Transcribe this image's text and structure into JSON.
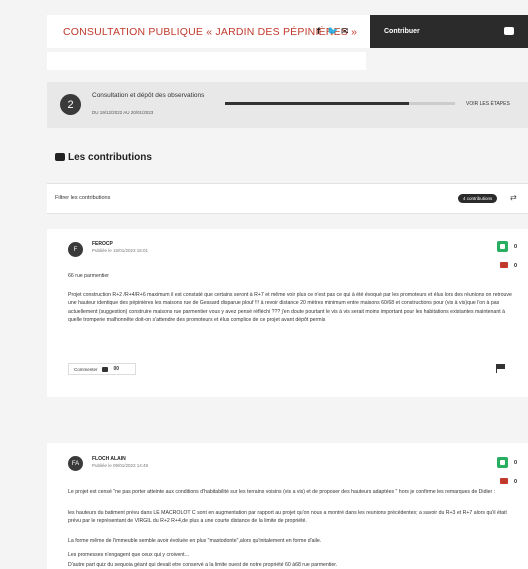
{
  "header": {
    "title": "CONSULTATION PUBLIQUE « JARDIN DES PÉPINIÈRES »",
    "share_icons": [
      "facebook-icon",
      "twitter-icon",
      "mail-icon"
    ],
    "contribute_label": "Contribuer"
  },
  "phase": {
    "number": "2",
    "label": "Consultation et dépôt des observations",
    "dates": "DU 19/12/2022 AU 20/01/2023",
    "progress": 0.8,
    "steps_link": "VOIR LES ÉTAPES"
  },
  "contributions": {
    "title": "Les contributions",
    "filter_label": "Filtrer les contributions",
    "count_label": "4 contributions"
  },
  "posts": [
    {
      "initial": "F",
      "author": "FEROCP",
      "date": "Publiée le 15/01/2023 16:01",
      "up": "0",
      "down": "0",
      "subject": "66 rue parmentier",
      "paragraphs": [
        "Projet construction R+2 /R+4/R+6 maximum il est constaté que certains seront à R+7 et même voir plus ce n'est pas ce qui à été évoqué par les promoteurs et élus lors des réunions on retrouve une hauteur identique des pépinières les maisons rue de Gessard disparue plouf !!! à revoir distance 20 mètres minimum entre maisons 60/68 et constructions pour (vis à vis)que l'on à pas actuellement (suggestion) construire maisons rue parmentier vous y avez pensé réfléchi ??? j'en doute pourtant le vis à vis serait moins important pour les habitations existantes maintenant à quelle tromperie malhonnête doit-on s'attendre des promoteurs et élus complice de ce projet avant dépôt permis"
      ],
      "comment_label": "Commenter",
      "comment_count": "00"
    },
    {
      "initial": "FA",
      "author": "FLOCH ALAIN",
      "date": "Publiée le 09/01/2023 14:49",
      "up": "0",
      "down": "0",
      "paragraphs": [
        "Le projet est censé \"ne pas porter atteinte aux conditions d'habitabilité sur les terrains voisins (vis a vis) et de proposer des hauteurs adaptées \" hors je confirme les remarques de Didier :",
        "les hauteurs du batiment prévu dans LE MACROLOT C sont en augmentation par rapport au projet qu'on nous a montré dans les reunions précédentes; a savoir du R+3 et R+7 alors qu'il était prévu par le représentant de VIRGIL du R+2 R+4,de plus a une courte distance de la limite de propriété.",
        "La forme même de l'immeuble semble avoir évoluée en plus \"mastodonte\",alors qu'initalement en forme d'aile.",
        "Les promesses n'engagent que ceux qui y croivent...",
        "D'autre part quiz du sequoia géant qui devait etre conservé a la limite ouest de notre propriété 60 à68 rue parmentier."
      ]
    }
  ]
}
